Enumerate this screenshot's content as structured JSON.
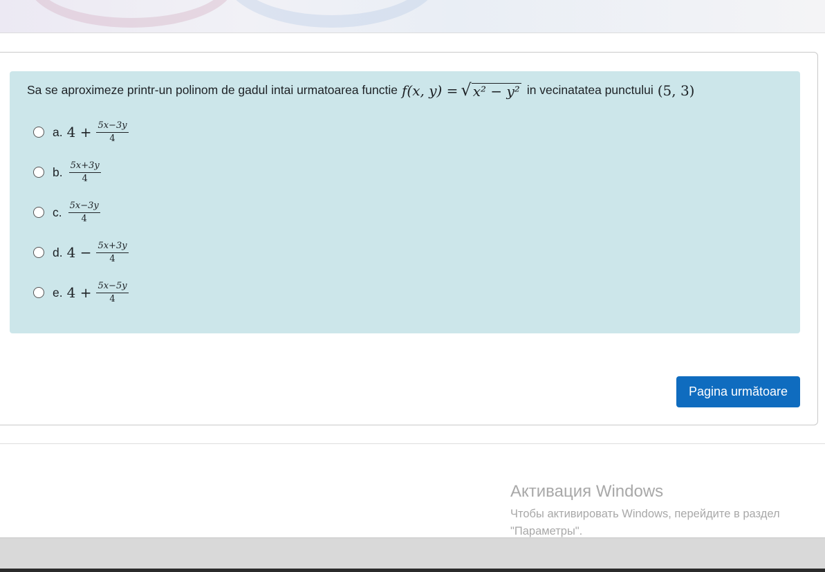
{
  "question": {
    "text_before": "Sa se aproximeze printr-un polinom de gadul intai urmatoarea functie",
    "function_lhs": "f(x, y) =",
    "function_radicand": "x² − y²",
    "text_middle": "in vecinatatea punctului",
    "point": "(5, 3)"
  },
  "options": [
    {
      "label": "a.",
      "prefix": "4 +",
      "numerator": "5x−3y",
      "denominator": "4"
    },
    {
      "label": "b.",
      "prefix": "",
      "numerator": "5x+3y",
      "denominator": "4"
    },
    {
      "label": "c.",
      "prefix": "",
      "numerator": "5x−3y",
      "denominator": "4"
    },
    {
      "label": "d.",
      "prefix": "4 −",
      "numerator": "5x+3y",
      "denominator": "4"
    },
    {
      "label": "e.",
      "prefix": "4 +",
      "numerator": "5x−5y",
      "denominator": "4"
    }
  ],
  "navigation": {
    "next_label": "Pagina următoare"
  },
  "watermark": {
    "title": "Активация Windows",
    "subtitle": "Чтобы активировать Windows, перейдите в раздел \"Параметры\"."
  },
  "colors": {
    "question_bg": "#cce6ea",
    "button_bg": "#0f6cbf"
  }
}
